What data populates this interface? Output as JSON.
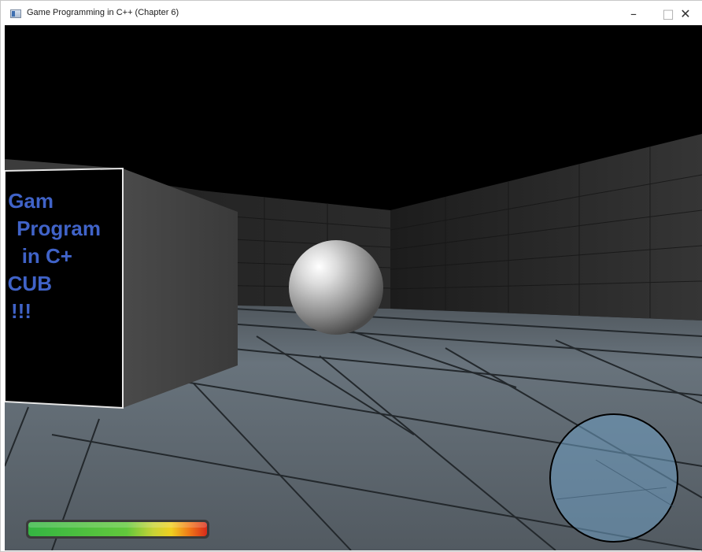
{
  "window": {
    "title": "Game Programming in C++ (Chapter 6)",
    "controls": {
      "minimize": "–",
      "maximize": "□",
      "close": "✕"
    }
  },
  "scene": {
    "sky_color": "#000000",
    "cube": {
      "label_lines": [
        "Gam",
        "Program",
        "in C+",
        "CUB",
        "!!!"
      ],
      "text_color": "#4063c8"
    },
    "sphere": {
      "color": "#d9d9d9"
    }
  },
  "hud": {
    "health": {
      "value": 1.0
    },
    "radar": {
      "fill": "#6f9fc2"
    }
  },
  "icons": [
    "app-icon",
    "minimize-icon",
    "maximize-icon",
    "close-icon"
  ]
}
